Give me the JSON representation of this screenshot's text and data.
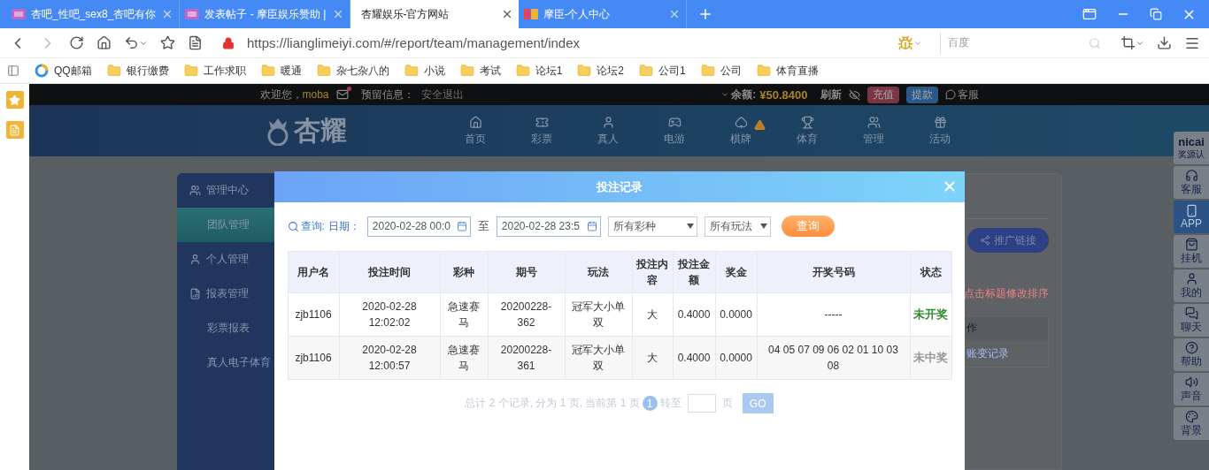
{
  "browser": {
    "tabs": [
      {
        "title": "杏吧_性吧_sex8_杏吧有你",
        "selected": false,
        "kind": "flag"
      },
      {
        "title": "发表帖子 - 摩臣娱乐赞助 |",
        "selected": false,
        "kind": "flag"
      },
      {
        "title": "杏耀娱乐-官方网站",
        "selected": true,
        "kind": "plain"
      },
      {
        "title": "摩臣-个人中心",
        "selected": false,
        "kind": "mc"
      }
    ],
    "url": "https://lianglimeiyi.com/#/report/team/management/index",
    "search_placeholder": "百度",
    "bookmarks": [
      {
        "label": "QQ邮箱",
        "kind": "app"
      },
      {
        "label": "银行缴费",
        "kind": "folder"
      },
      {
        "label": "工作求职",
        "kind": "folder"
      },
      {
        "label": "暖通",
        "kind": "folder"
      },
      {
        "label": "杂七杂八的",
        "kind": "folder"
      },
      {
        "label": "小说",
        "kind": "folder"
      },
      {
        "label": "考试",
        "kind": "folder"
      },
      {
        "label": "论坛1",
        "kind": "folder"
      },
      {
        "label": "论坛2",
        "kind": "folder"
      },
      {
        "label": "公司1",
        "kind": "folder"
      },
      {
        "label": "公司",
        "kind": "folder"
      },
      {
        "label": "体育直播",
        "kind": "folder"
      }
    ]
  },
  "page": {
    "top_bar": {
      "welcome": "欢迎您，",
      "username": "moba",
      "unread_mail": true,
      "reserved_label": "预留信息：",
      "logout": "安全退出",
      "balance_label": "余额:",
      "balance": "¥50.8400",
      "refresh": "刷新",
      "recharge": "充值",
      "withdraw": "提款",
      "service": "客服"
    },
    "logo": "杏耀",
    "nav": [
      {
        "label": "首页",
        "kind": "home",
        "alert": false
      },
      {
        "label": "彩票",
        "kind": "ticket",
        "alert": false
      },
      {
        "label": "真人",
        "kind": "person",
        "alert": false
      },
      {
        "label": "电游",
        "kind": "game",
        "alert": false
      },
      {
        "label": "棋牌",
        "kind": "cards",
        "alert": true
      },
      {
        "label": "体育",
        "kind": "trophy",
        "alert": false
      },
      {
        "label": "管理",
        "kind": "users",
        "alert": false
      },
      {
        "label": "活动",
        "kind": "gift",
        "alert": false
      }
    ],
    "sidebar": [
      {
        "label": "管理中心",
        "kind": "group",
        "selected": false
      },
      {
        "label": "团队管理",
        "kind": "item",
        "selected": true
      },
      {
        "label": "个人管理",
        "kind": "group",
        "selected": false
      },
      {
        "label": "报表管理",
        "kind": "group",
        "selected": false
      },
      {
        "label": "彩票报表",
        "kind": "item",
        "selected": false
      },
      {
        "label": "真人电子体育",
        "kind": "item",
        "selected": false
      }
    ],
    "content": {
      "share_button": "推广链接",
      "sort_hint": "点击标题修改排序",
      "column_header": "作",
      "link": "账变记录"
    },
    "float_toolbar": [
      {
        "label": "奖源认",
        "kind": "badge",
        "selected": false
      },
      {
        "label": "客服",
        "kind": "service",
        "selected": false
      },
      {
        "label": "APP",
        "kind": "phone",
        "selected": true
      },
      {
        "label": "挂机",
        "kind": "bag",
        "selected": false
      },
      {
        "label": "我的",
        "kind": "user",
        "selected": false
      },
      {
        "label": "聊天",
        "kind": "chat",
        "selected": false
      },
      {
        "label": "帮助",
        "kind": "help",
        "selected": false
      },
      {
        "label": "声音",
        "kind": "sound",
        "selected": false
      },
      {
        "label": "背景",
        "kind": "palette",
        "selected": false
      }
    ],
    "badge_logo": "nicai"
  },
  "modal": {
    "title": "投注记录",
    "filters": {
      "query_label": "查询:",
      "date_label": "日期：",
      "start": "2020-02-28 00:0",
      "to": "至",
      "end": "2020-02-28 23:5",
      "lottery": "所有彩种",
      "play": "所有玩法",
      "submit": "查询"
    },
    "table": {
      "columns": [
        "用户名",
        "投注时间",
        "彩种",
        "期号",
        "玩法",
        "投注内容",
        "投注金额",
        "奖金",
        "开奖号码",
        "状态"
      ],
      "rows": [
        {
          "cells": [
            "zjb1106",
            "2020-02-28 12:02:02",
            "急速赛马",
            "20200228-362",
            "冠军大小单双",
            "大",
            "0.4000",
            "0.0000",
            "-----"
          ],
          "status": "未开奖",
          "color": "#2e8b2e"
        },
        {
          "cells": [
            "zjb1106",
            "2020-02-28 12:00:57",
            "急速赛马",
            "20200228-361",
            "冠军大小单双",
            "大",
            "0.4000",
            "0.0000",
            "04 05 07 09 06 02 01 10 03 08"
          ],
          "status": "未中奖",
          "color": "#999999"
        }
      ]
    },
    "pagination": {
      "summary": "总计 2 个记录, 分为 1 页, 当前第 1 页",
      "current": "1",
      "goto": "转至",
      "unit": "页",
      "go": "GO"
    }
  }
}
